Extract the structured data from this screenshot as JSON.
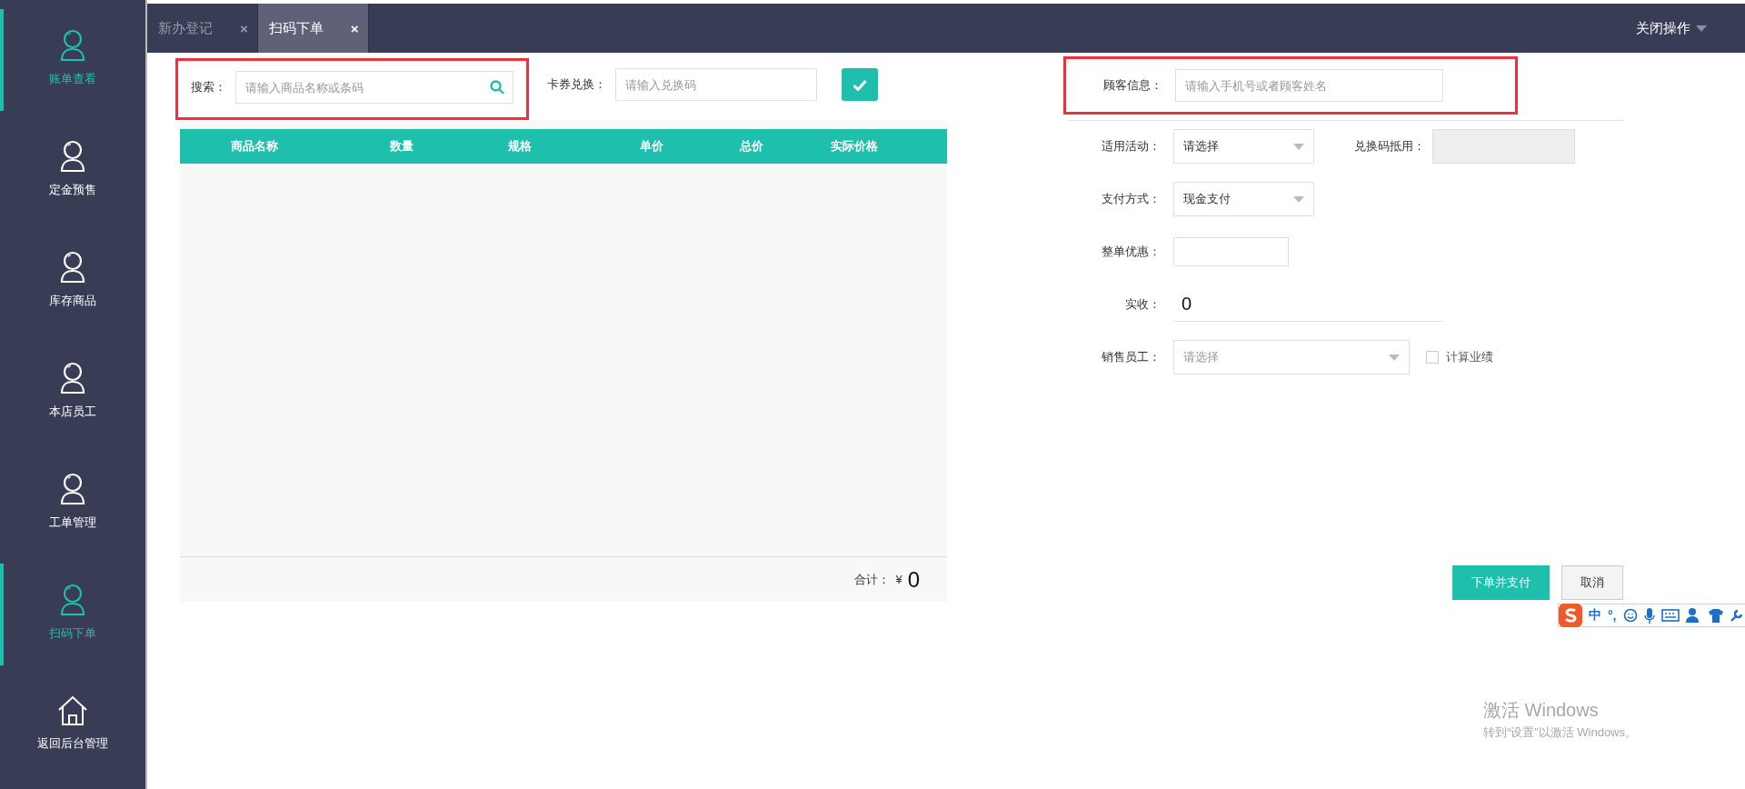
{
  "sidebar": {
    "items": [
      {
        "label": "账单查看",
        "kind": "person",
        "selected": true
      },
      {
        "label": "定金预售",
        "kind": "person",
        "selected": false
      },
      {
        "label": "库存商品",
        "kind": "person",
        "selected": false
      },
      {
        "label": "本店员工",
        "kind": "person",
        "selected": false
      },
      {
        "label": "工单管理",
        "kind": "person",
        "selected": false
      },
      {
        "label": "扫码下单",
        "kind": "person",
        "selected": true
      },
      {
        "label": "返回后台管理",
        "kind": "house",
        "selected": false
      }
    ]
  },
  "tabs": [
    {
      "label": "新办登记",
      "close": "×",
      "selected": false
    },
    {
      "label": "扫码下单",
      "close": "×",
      "selected": true
    }
  ],
  "close_menu": {
    "label": "关闭操作"
  },
  "search": {
    "label": "搜索：",
    "placeholder": "请输入商品名称或条码",
    "highlighted": true
  },
  "coupon": {
    "label": "卡券兑换：",
    "placeholder": "请输入兑换码"
  },
  "table": {
    "columns": [
      "商品名称",
      "数量",
      "规格",
      "单价",
      "总价",
      "实际价格"
    ]
  },
  "total": {
    "label": "合计：",
    "currency": "¥",
    "value": "0"
  },
  "customer": {
    "label": "顾客信息：",
    "placeholder": "请输入手机号或者顾客姓名",
    "highlighted": true
  },
  "form": {
    "rows": [
      {
        "kind": "select",
        "label": "适用活动：",
        "value": "请选择",
        "extra": {
          "label": "兑换码抵用：",
          "disabled": true
        }
      },
      {
        "kind": "select",
        "label": "支付方式：",
        "value": "现金支付"
      },
      {
        "kind": "input",
        "label": "整单优惠："
      },
      {
        "kind": "amount",
        "label": "实收：",
        "value": "0"
      },
      {
        "kind": "select",
        "label": "销售员工：",
        "placeholder": "请选择",
        "checkbox": {
          "label": "计算业绩",
          "checked": false
        }
      }
    ]
  },
  "buttons": [
    {
      "label": "下单并支付",
      "kind": "primary"
    },
    {
      "label": "取消",
      "kind": "default"
    }
  ],
  "ime_toolbar": {
    "mode": "中",
    "punctuation": "°,"
  },
  "windows_notice": {
    "title": "激活 Windows",
    "text": "转到“设置”以激活 Windows。"
  }
}
